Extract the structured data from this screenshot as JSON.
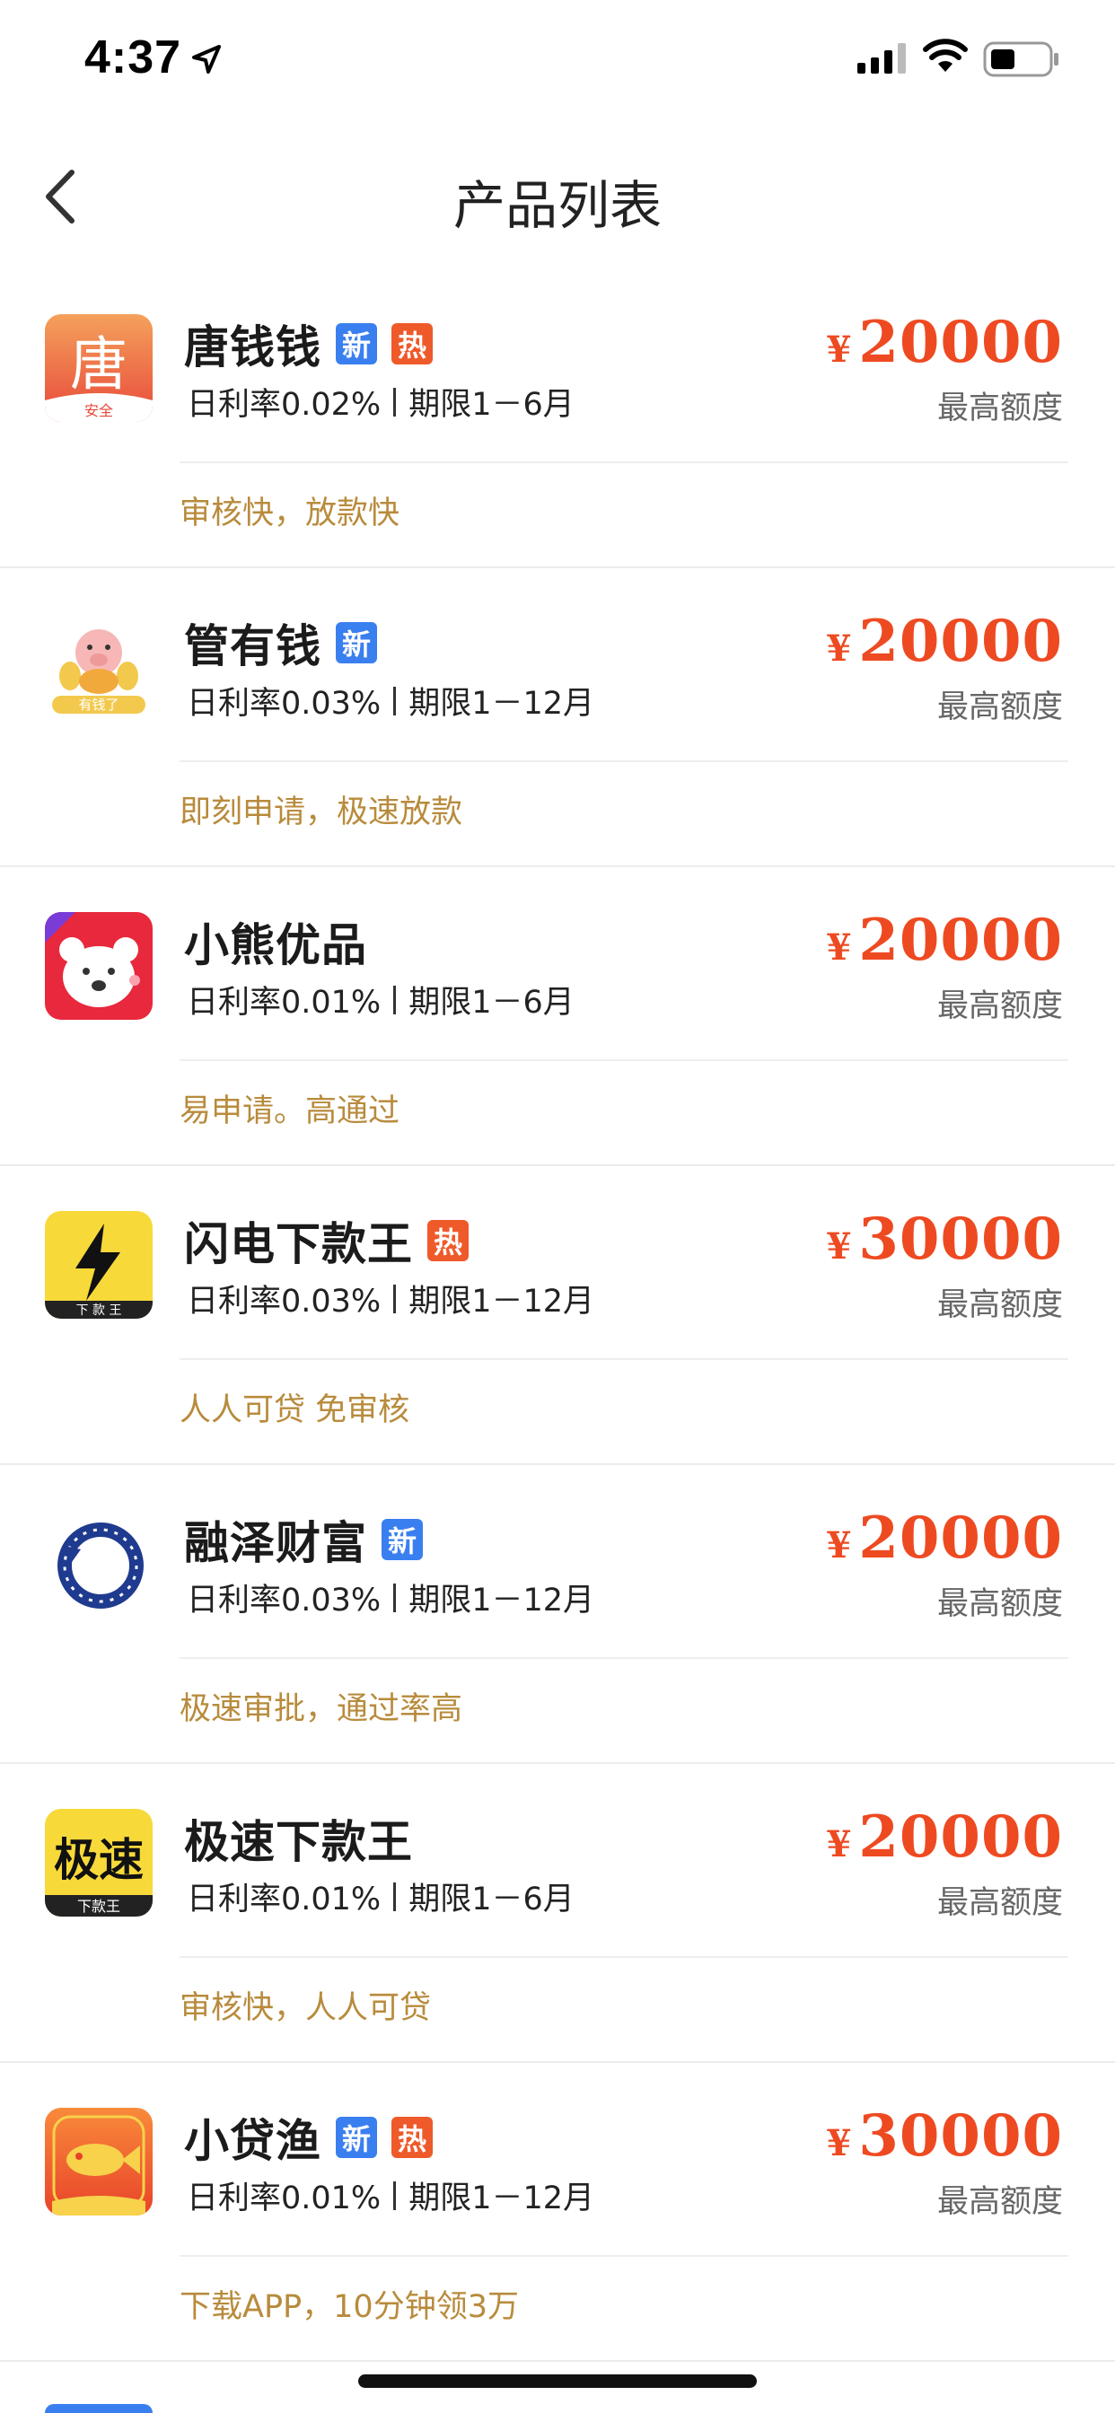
{
  "status_bar": {
    "time": "4:37"
  },
  "nav": {
    "title": "产品列表"
  },
  "products": [
    {
      "name": "唐钱钱",
      "tags": [
        "新",
        "热"
      ],
      "rate": "日利率0.02%",
      "term": "期限1－6月",
      "currency": "¥",
      "amount": "20000",
      "amount_label": "最高额度",
      "slogan": "审核快，放款快",
      "logo_icon": "tang-logo-icon",
      "logo_text": "唐",
      "logo_sub": "安全"
    },
    {
      "name": "管有钱",
      "tags": [
        "新"
      ],
      "rate": "日利率0.03%",
      "term": "期限1－12月",
      "currency": "¥",
      "amount": "20000",
      "amount_label": "最高额度",
      "slogan": "即刻申请，极速放款",
      "logo_icon": "pig-logo-icon",
      "logo_sub": "有钱了"
    },
    {
      "name": "小熊优品",
      "tags": [],
      "rate": "日利率0.01%",
      "term": "期限1－6月",
      "currency": "¥",
      "amount": "20000",
      "amount_label": "最高额度",
      "slogan": "易申请。高通过",
      "logo_icon": "bear-logo-icon"
    },
    {
      "name": "闪电下款王",
      "tags": [
        "热"
      ],
      "rate": "日利率0.03%",
      "term": "期限1－12月",
      "currency": "¥",
      "amount": "30000",
      "amount_label": "最高额度",
      "slogan": "人人可贷 免审核",
      "logo_icon": "lightning-logo-icon",
      "logo_sub": "下 款 王"
    },
    {
      "name": "融泽财富",
      "tags": [
        "新"
      ],
      "rate": "日利率0.03%",
      "term": "期限1－12月",
      "currency": "¥",
      "amount": "20000",
      "amount_label": "最高额度",
      "slogan": "极速审批，通过率高",
      "logo_icon": "ring-logo-icon"
    },
    {
      "name": "极速下款王",
      "tags": [],
      "rate": "日利率0.01%",
      "term": "期限1－6月",
      "currency": "¥",
      "amount": "20000",
      "amount_label": "最高额度",
      "slogan": "审核快，人人可贷",
      "logo_icon": "jisu-logo-icon",
      "logo_text": "极速",
      "logo_sub": "下款王"
    },
    {
      "name": "小贷渔",
      "tags": [
        "新",
        "热"
      ],
      "rate": "日利率0.01%",
      "term": "期限1－12月",
      "currency": "¥",
      "amount": "30000",
      "amount_label": "最高额度",
      "slogan": "下载APP，10分钟领3万",
      "logo_icon": "fish-logo-icon"
    }
  ],
  "colors": {
    "accent_red": "#ee4a22",
    "tag_new": "#3a7ff0",
    "tag_hot": "#ef5a2a",
    "slogan": "#b88b3c"
  }
}
